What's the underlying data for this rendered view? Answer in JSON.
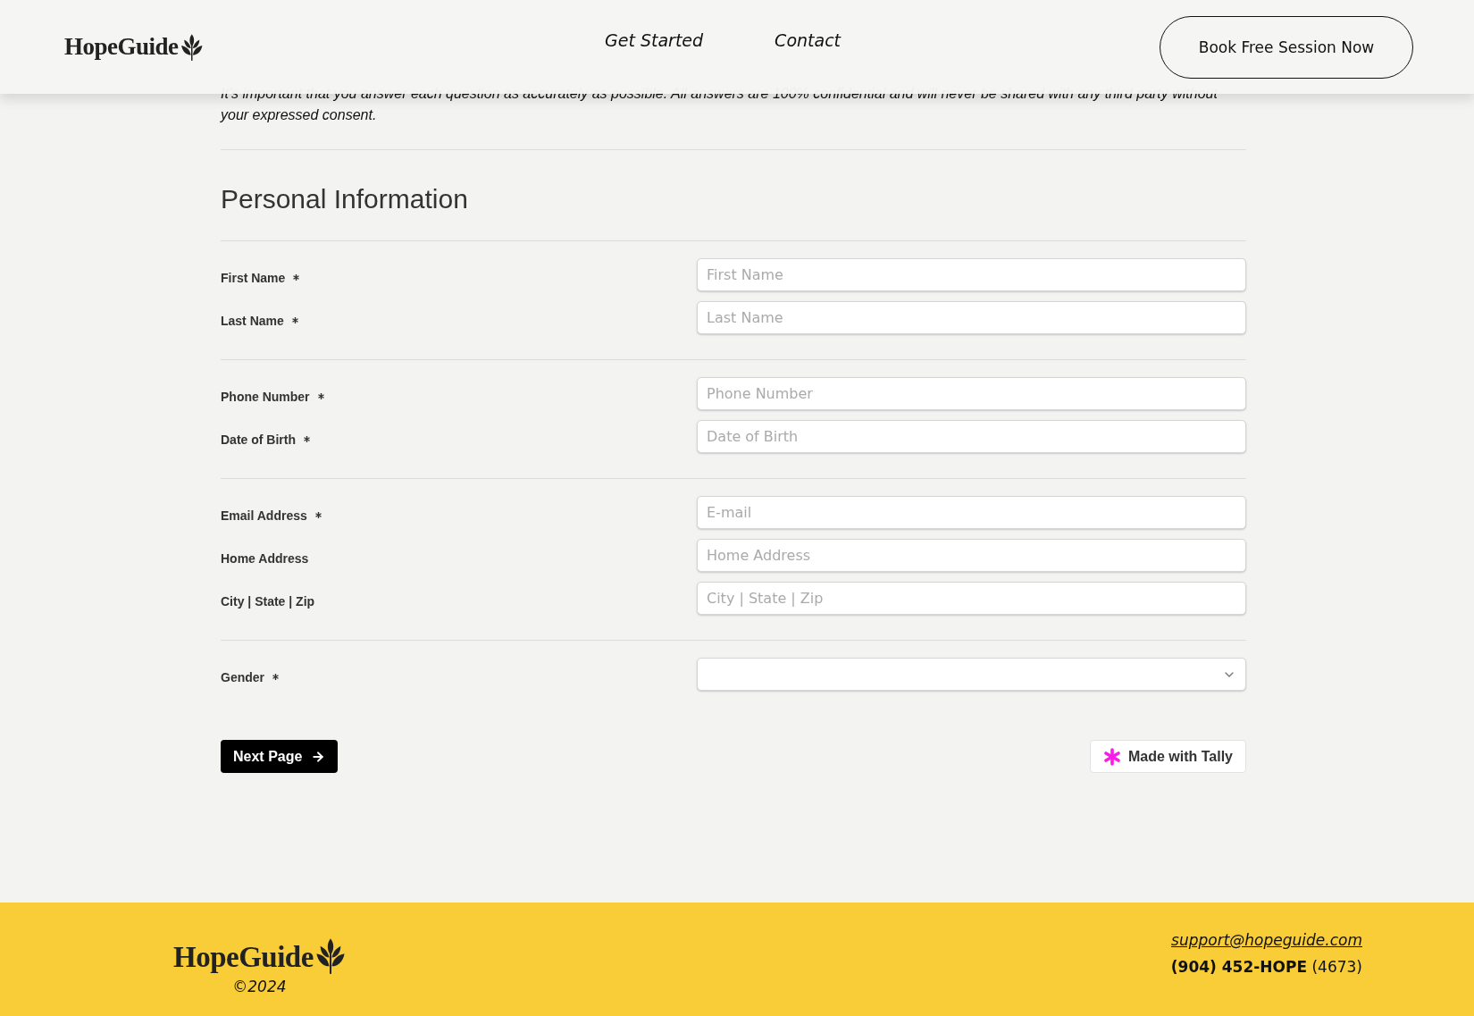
{
  "header": {
    "logo": "HopeGuide",
    "nav": [
      "Get Started",
      "Contact"
    ],
    "cta": "Book Free Session Now"
  },
  "intro": "It's important that you answer each question as accurately as possible.  All answers are 100% confidential and will never be shared with any third party without your expressed consent.",
  "form": {
    "title": "Personal Information",
    "groups": [
      [
        {
          "kind": "text",
          "label": "First Name",
          "required": true,
          "placeholder": "First Name"
        },
        {
          "kind": "text",
          "label": "Last Name",
          "required": true,
          "placeholder": "Last Name"
        }
      ],
      [
        {
          "kind": "text",
          "label": "Phone Number",
          "required": true,
          "placeholder": "Phone Number"
        },
        {
          "kind": "text",
          "label": "Date of Birth",
          "required": true,
          "placeholder": "Date of Birth"
        }
      ],
      [
        {
          "kind": "text",
          "label": "Email Address",
          "required": true,
          "placeholder": "E-mail"
        },
        {
          "kind": "text",
          "label": "Home Address",
          "required": false,
          "placeholder": "Home Address"
        },
        {
          "kind": "text",
          "label": "City | State | Zip",
          "required": false,
          "placeholder": "City | State | Zip"
        }
      ],
      [
        {
          "kind": "select",
          "label": "Gender",
          "required": true
        }
      ]
    ],
    "next_button": "Next Page",
    "badge": "Made with Tally"
  },
  "footer": {
    "logo": "HopeGuide",
    "copyright": "©2024",
    "email": "support@hopeguide.com",
    "phone": "**(904) 452-HOPE** (4673)"
  }
}
